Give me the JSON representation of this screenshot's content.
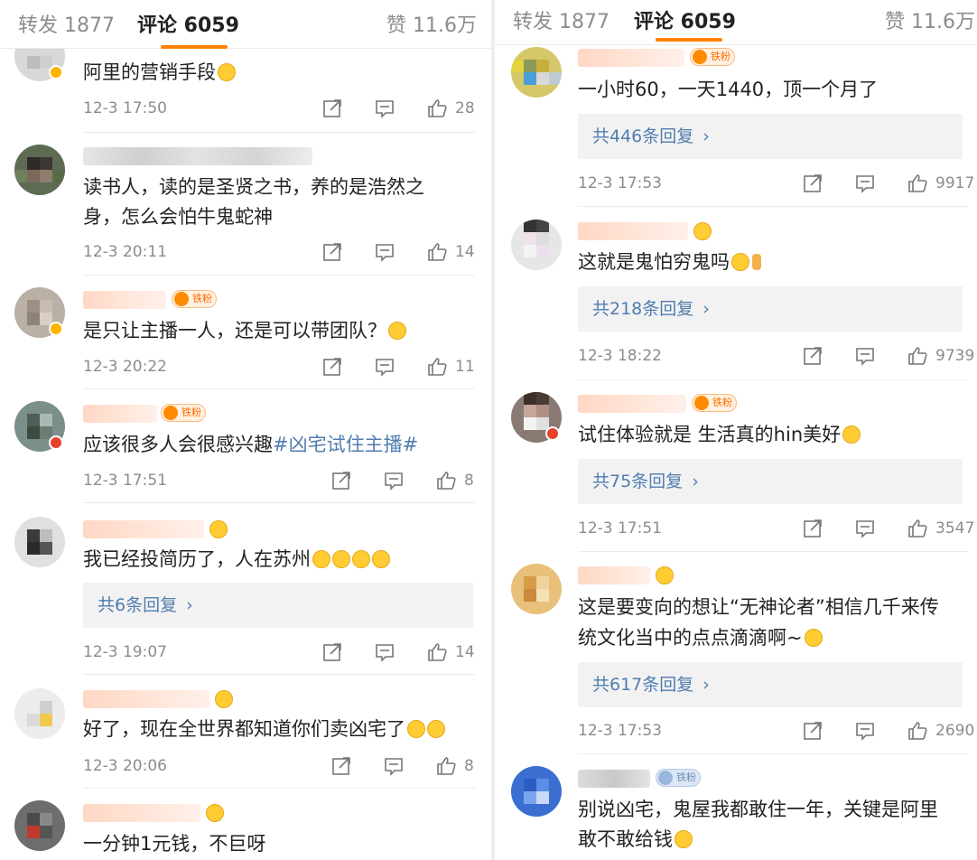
{
  "tabs": {
    "reposts": "转发 1877",
    "comments": "评论 6059",
    "likes": "赞 11.6万"
  },
  "colors": {
    "accent": "#ff8200",
    "link": "#507daf",
    "muted": "#8c8c8c"
  },
  "icons": [
    "share-icon",
    "comment-icon",
    "like-icon",
    "chevron-right-icon",
    "emoji-icon"
  ],
  "left_comments": [
    {
      "text": "阿里的营销手段",
      "time": "12-3 17:50",
      "likes": "28"
    },
    {
      "text_line1": "读书人，读的是圣贤之书，养的是浩然之",
      "text_line2": "身，怎么会怕牛鬼蛇神",
      "time": "12-3 20:11",
      "likes": "14"
    },
    {
      "text": "是只让主播一人，还是可以带团队？",
      "time": "12-3 20:22",
      "likes": "11",
      "badge": "铁粉"
    },
    {
      "text": "应该很多人会很感兴趣",
      "hashtag": "#凶宅试住主播#",
      "time": "12-3 17:51",
      "likes": "8",
      "badge": "铁粉"
    },
    {
      "text": "我已经投简历了，人在苏州",
      "replies": "共6条回复",
      "time": "12-3 19:07",
      "likes": "14"
    },
    {
      "text": "好了，现在全世界都知道你们卖凶宅了",
      "time": "12-3 20:06",
      "likes": "8"
    },
    {
      "text": "一分钟1元钱，不巨呀"
    }
  ],
  "right_comments": [
    {
      "text": "一小时60，一天1440，顶一个月了",
      "replies": "共446条回复",
      "time": "12-3 17:53",
      "likes": "9917",
      "badge": "铁粉"
    },
    {
      "text": "这就是鬼怕穷鬼吗",
      "replies": "共218条回复",
      "time": "12-3 18:22",
      "likes": "9739"
    },
    {
      "text": "试住体验就是 生活真的hin美好",
      "replies": "共75条回复",
      "time": "12-3 17:51",
      "likes": "3547",
      "badge": "铁粉"
    },
    {
      "text_line1": "这是要变向的想让“无神论者”相信几千来传",
      "text_line2": "统文化当中的点点滴滴啊~",
      "replies": "共617条回复",
      "time": "12-3 17:53",
      "likes": "2690"
    },
    {
      "text_line1": "别说凶宅，鬼屋我都敢住一年，关键是阿里",
      "text_line2": "敢不敢给钱",
      "badge": "铁粉"
    }
  ]
}
